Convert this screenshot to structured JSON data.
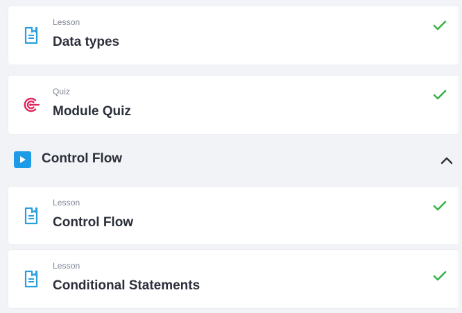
{
  "items_before": [
    {
      "kicker": "Lesson",
      "title": "Data types",
      "icon": "lesson-document-icon",
      "completed": true
    },
    {
      "kicker": "Quiz",
      "title": "Module Quiz",
      "icon": "quiz-target-icon",
      "completed": true
    }
  ],
  "section": {
    "title": "Control Flow",
    "icon": "play-icon",
    "expanded": true,
    "toggle_icon": "chevron-up-icon"
  },
  "items_after": [
    {
      "kicker": "Lesson",
      "title": "Control Flow",
      "icon": "lesson-document-icon",
      "completed": true
    },
    {
      "kicker": "Lesson",
      "title": "Conditional Statements",
      "icon": "lesson-document-icon",
      "completed": true
    }
  ],
  "colors": {
    "lesson_icon": "#2a9fe0",
    "quiz_icon": "#e0245e",
    "check": "#3ab34a",
    "section_icon": "#1e9be6"
  }
}
